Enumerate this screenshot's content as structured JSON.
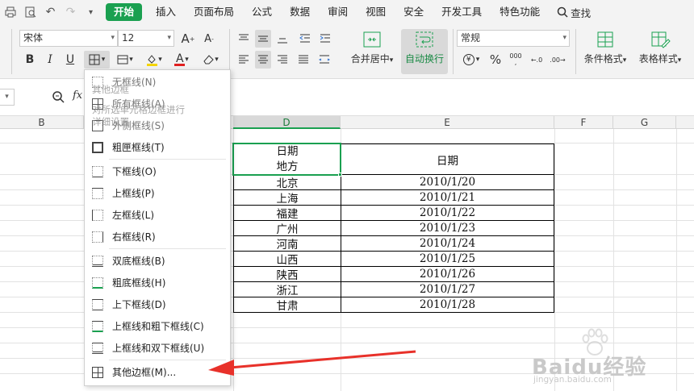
{
  "menu": {
    "active_tab": "开始",
    "tabs": [
      "插入",
      "页面布局",
      "公式",
      "数据",
      "审阅",
      "视图",
      "安全",
      "开发工具",
      "特色功能"
    ],
    "search": "查找"
  },
  "ribbon": {
    "font_name": "宋体",
    "font_size": "12",
    "bold": "B",
    "italic": "I",
    "underline": "U",
    "font_color_letter": "A",
    "merge_center": "合并居中",
    "wrap_text": "自动换行",
    "number_format": "常规",
    "percent": "%",
    "thousands": "000",
    "cond_format": "条件格式",
    "table_style": "表格样式",
    "increase_font": "A",
    "decrease_font": "A"
  },
  "formula_bar": {
    "fx": "fx"
  },
  "columns": [
    "B",
    "D",
    "E",
    "F",
    "G"
  ],
  "table": {
    "header_left_top": "日期",
    "header_left_bottom": "地方",
    "header_right": "日期",
    "rows": [
      [
        "北京",
        "2010/1/20"
      ],
      [
        "上海",
        "2010/1/21"
      ],
      [
        "福建",
        "2010/1/22"
      ],
      [
        "广州",
        "2010/1/23"
      ],
      [
        "河南",
        "2010/1/24"
      ],
      [
        "山西",
        "2010/1/25"
      ],
      [
        "陕西",
        "2010/1/26"
      ],
      [
        "浙江",
        "2010/1/27"
      ],
      [
        "甘肃",
        "2010/1/28"
      ]
    ]
  },
  "dropdown": {
    "items": [
      "无框线(N)",
      "所有框线(A)",
      "外侧框线(S)",
      "粗匣框线(T)",
      "下框线(O)",
      "上框线(P)",
      "左框线(L)",
      "右框线(R)",
      "双底框线(B)",
      "粗底框线(H)",
      "上下框线(D)",
      "上框线和粗下框线(C)",
      "上框线和双下框线(U)",
      "其他边框(M)..."
    ],
    "ghost_tip_title": "其他边框",
    "ghost_tip_line1": "对所选单元格边框进行",
    "ghost_tip_line2": "详细设置"
  },
  "watermark": {
    "brand": "Baidu经验",
    "url": "jingyan.baidu.com"
  },
  "colors": {
    "accent": "#1aa050",
    "arrow": "#e8312a"
  }
}
